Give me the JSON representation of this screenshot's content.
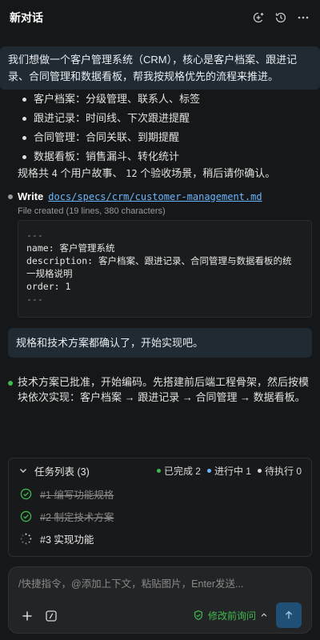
{
  "header": {
    "title": "新对话"
  },
  "messages": {
    "user_1": "我们想做一个客户管理系统（CRM），核心是客户档案、跟进记录、合同管理和数据看板，帮我按规格优先的流程来推进。",
    "bullets": [
      "客户档案：分级管理、联系人、标签",
      "跟进记录：时间线、下次跟进提醒",
      "合同管理：合同关联、到期提醒",
      "数据看板：销售漏斗、转化统计"
    ],
    "summary_prefix": "规格共",
    "summary_stories": "4",
    "summary_mid": "个用户故事、",
    "summary_scenarios": "12",
    "summary_suffix": "个验收场景，稍后请你确认。",
    "write_label": "Write",
    "write_path": "docs/specs/crm/customer-management.md",
    "file_meta": "File created (19 lines, 380 characters)",
    "code": {
      "line1": "---",
      "line2": "name: 客户管理系统",
      "line3": "description: 客户档案、跟进记录、合同管理与数据看板的统",
      "line4": "一规格说明",
      "line5": "order: 1",
      "line6": "---"
    },
    "user_2": "规格和技术方案都确认了，开始实现吧。",
    "assistant": "技术方案已批准，开始编码。先搭建前后端工程骨架，然后按模块依次实现：客户档案 → 跟进记录 → 合同管理 → 数据看板。"
  },
  "tasks": {
    "title": "任务列表 (3)",
    "stats": {
      "done": "已完成 2",
      "progress": "进行中 1",
      "pending": "待执行 0"
    },
    "items": [
      {
        "label": "#1 编写功能规格",
        "status": "done"
      },
      {
        "label": "#2 制定技术方案",
        "status": "done"
      },
      {
        "label": "#3 实现功能",
        "status": "in_progress"
      }
    ]
  },
  "composer": {
    "placeholder": "/快捷指令，@添加上下文，粘贴图片，Enter发送...",
    "mode_label": "修改前询问"
  },
  "colors": {
    "accent_green": "#3fb950",
    "accent_blue": "#6cb6ff",
    "send_button": "#1f4f74"
  }
}
